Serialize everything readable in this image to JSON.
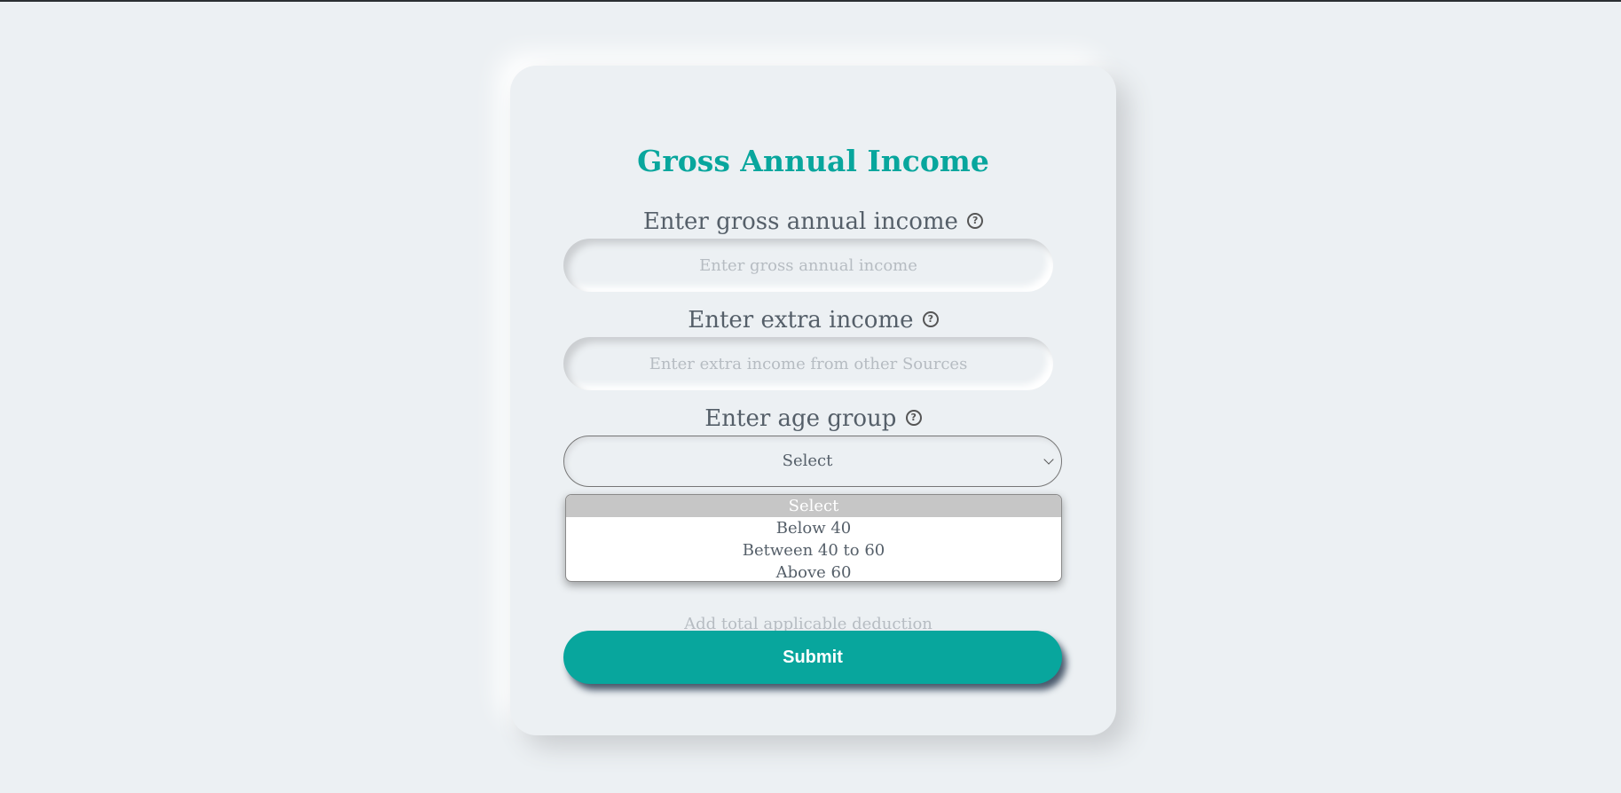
{
  "form": {
    "title": "Gross Annual Income",
    "gross_income": {
      "label": "Enter gross annual income",
      "placeholder": "Enter gross annual income",
      "value": ""
    },
    "extra_income": {
      "label": "Enter extra income",
      "placeholder": "Enter extra income from other Sources",
      "value": ""
    },
    "age_group": {
      "label": "Enter age group",
      "selected": "Select",
      "options": [
        "Select",
        "Below 40",
        "Between 40 to 60",
        "Above 60"
      ]
    },
    "deductions": {
      "placeholder_partial": "Add total applicable deduction"
    },
    "submit_label": "Submit"
  },
  "icons": {
    "help": "question-circle",
    "select_arrow": "chevron-down"
  },
  "colors": {
    "accent": "#08a69d",
    "background": "#ecf0f3",
    "label_text": "#555f69",
    "placeholder_text": "#b6bcc2",
    "dropdown_highlight": "#c6c6c6"
  }
}
